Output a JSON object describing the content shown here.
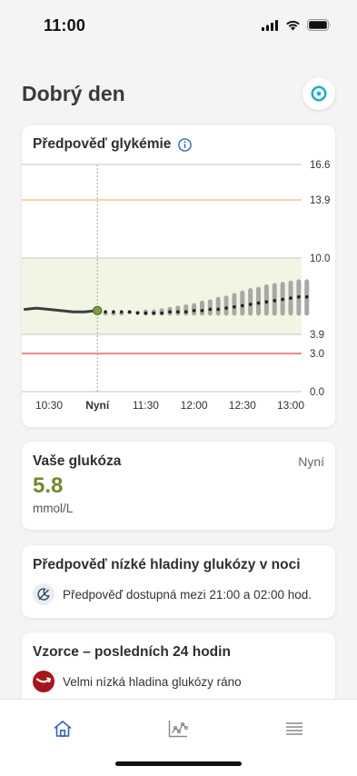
{
  "status": {
    "time": "11:00"
  },
  "header": {
    "greeting": "Dobrý den"
  },
  "forecast_card": {
    "title": "Předpověď glykémie",
    "info_icon": "info-icon",
    "colors": {
      "target_range": "#f1f6e4",
      "high_line": "#f3c791",
      "low_line": "#e3646a",
      "history_line": "#3d3d3d",
      "forecast_band": "#a7a9a5",
      "current_point": "#7aa13b"
    }
  },
  "glucose_card": {
    "title": "Vaše glukóza",
    "time": "Nyní",
    "value": "5.8",
    "unit": "mmol/L"
  },
  "low_card": {
    "title": "Předpověď nízké hladiny glukózy v noci",
    "icon": "moon-clock-icon",
    "text": "Předpověď dostupná mezi 21:00 a 02:00 hod."
  },
  "patterns_card": {
    "title": "Vzorce – posledních 24 hodin",
    "icon": "low-glucose-icon",
    "text": "Velmi nízká hladina glukózy ráno"
  },
  "tabs": [
    {
      "name": "home",
      "icon": "home-icon",
      "active": true
    },
    {
      "name": "history",
      "icon": "chart-icon",
      "active": false
    },
    {
      "name": "menu",
      "icon": "menu-icon",
      "active": false
    }
  ],
  "chart_data": {
    "type": "line",
    "title": "Předpověď glykémie",
    "xlabel": "",
    "ylabel": "",
    "x_ticks": [
      "10:30",
      "Nyní",
      "11:30",
      "12:00",
      "12:30",
      "13:00"
    ],
    "y_ticks": [
      "16.6",
      "13.9",
      "10.0",
      "3.9",
      "3.0",
      "0.0"
    ],
    "y_scale": "non-linear (piecewise)",
    "target_range": [
      3.9,
      10.0
    ],
    "thresholds": {
      "high": 13.9,
      "low": 3.0
    },
    "now": "11:00",
    "series": [
      {
        "kind": "history",
        "x": [
          "10:15",
          "10:22",
          "10:30",
          "10:37",
          "10:45",
          "10:52",
          "11:00"
        ],
        "y": [
          5.9,
          6.0,
          5.9,
          5.8,
          5.7,
          5.7,
          5.8
        ]
      },
      {
        "kind": "forecast",
        "x": [
          "11:05",
          "11:10",
          "11:15",
          "11:20",
          "11:25",
          "11:30",
          "11:35",
          "11:40",
          "11:45",
          "11:50",
          "11:55",
          "12:00",
          "12:05",
          "12:10",
          "12:15",
          "12:20",
          "12:25",
          "12:30",
          "12:35",
          "12:40",
          "12:45",
          "12:50",
          "12:55",
          "13:00",
          "13:05",
          "13:10"
        ],
        "y": [
          5.7,
          5.7,
          5.7,
          5.7,
          5.6,
          5.6,
          5.6,
          5.6,
          5.7,
          5.7,
          5.7,
          5.8,
          5.8,
          5.9,
          5.9,
          6.0,
          6.1,
          6.2,
          6.3,
          6.4,
          6.5,
          6.6,
          6.7,
          6.8,
          6.9,
          6.9
        ],
        "low": [
          5.7,
          5.7,
          5.7,
          5.6,
          5.5,
          5.4,
          5.4,
          5.4,
          5.4,
          5.4,
          5.4,
          5.4,
          5.4,
          5.4,
          5.4,
          5.4,
          5.4,
          5.4,
          5.4,
          5.4,
          5.4,
          5.4,
          5.4,
          5.4,
          5.4,
          5.4
        ],
        "high": [
          5.7,
          5.7,
          5.7,
          5.8,
          5.8,
          5.9,
          5.9,
          6.0,
          6.1,
          6.2,
          6.3,
          6.4,
          6.6,
          6.7,
          6.9,
          7.0,
          7.2,
          7.4,
          7.6,
          7.7,
          7.9,
          8.0,
          8.1,
          8.2,
          8.3,
          8.3
        ]
      }
    ]
  }
}
